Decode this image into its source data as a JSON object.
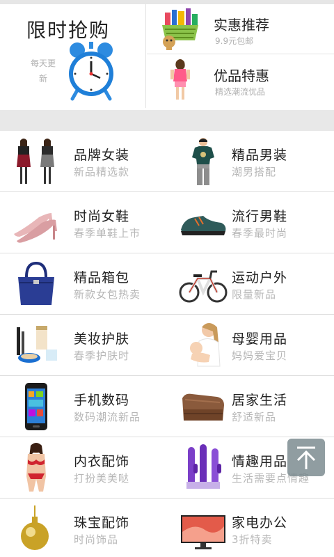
{
  "promo": {
    "flash_sale": {
      "title": "限时抢购",
      "subtitle": "每天更新",
      "icon": "alarm-clock-icon"
    },
    "deals": [
      {
        "title": "实惠推荐",
        "subtitle": "9.9元包邮",
        "icon": "shopping-basket-icon"
      },
      {
        "title": "优品特惠",
        "subtitle": "精选潮流优品",
        "icon": "fashion-model-icon"
      }
    ]
  },
  "categories": [
    {
      "title": "品牌女装",
      "subtitle": "新品精选款",
      "icon": "women-dress-icon"
    },
    {
      "title": "精品男装",
      "subtitle": "潮男搭配",
      "icon": "men-tshirt-icon"
    },
    {
      "title": "时尚女鞋",
      "subtitle": "春季单鞋上市",
      "icon": "high-heel-icon"
    },
    {
      "title": "流行男鞋",
      "subtitle": "春季最时尚",
      "icon": "sneaker-icon"
    },
    {
      "title": "精品箱包",
      "subtitle": "新款女包热卖",
      "icon": "handbag-icon"
    },
    {
      "title": "运动户外",
      "subtitle": "限量新品",
      "icon": "bicycle-icon"
    },
    {
      "title": "美妆护肤",
      "subtitle": "春季护肤时",
      "icon": "cosmetics-icon"
    },
    {
      "title": "母婴用品",
      "subtitle": "妈妈爱宝贝",
      "icon": "mother-baby-icon"
    },
    {
      "title": "手机数码",
      "subtitle": "数码潮流新品",
      "icon": "smartphone-icon"
    },
    {
      "title": "居家生活",
      "subtitle": "舒适新品",
      "icon": "sofa-icon"
    },
    {
      "title": "内衣配饰",
      "subtitle": "打扮美美哒",
      "icon": "lingerie-icon"
    },
    {
      "title": "情趣用品",
      "subtitle": "生活需要点情趣",
      "icon": "adult-toy-icon"
    },
    {
      "title": "珠宝配饰",
      "subtitle": "时尚饰品",
      "icon": "pearl-pendant-icon"
    },
    {
      "title": "家电办公",
      "subtitle": "3折特卖",
      "icon": "television-icon"
    }
  ],
  "back_to_top": {
    "icon": "back-to-top-icon"
  },
  "colors": {
    "title": "#222222",
    "subtitle": "#b7b7b7",
    "divider": "#dedede",
    "back_to_top_bg": "#78878c"
  }
}
